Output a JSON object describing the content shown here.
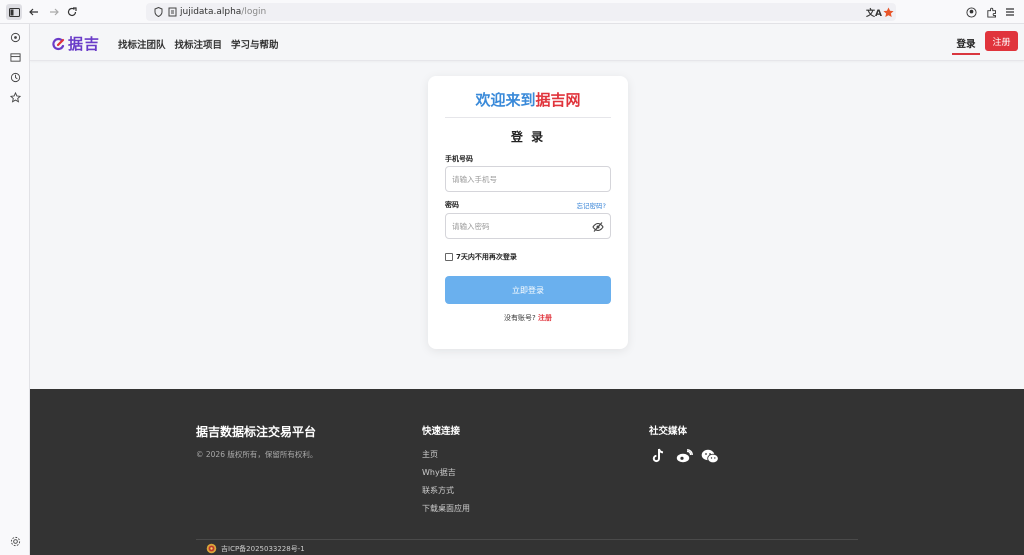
{
  "browser": {
    "url_host": "jujidata.alpha",
    "url_path": "/login"
  },
  "header": {
    "logo_text": "据吉",
    "nav": [
      "找标注团队",
      "找标注项目",
      "学习与帮助"
    ],
    "login_label": "登录",
    "register_label": "注册"
  },
  "card": {
    "welcome_part1": "欢迎来到",
    "welcome_part2": "据吉网",
    "title": "登 录",
    "phone_label": "手机号码",
    "phone_placeholder": "请输入手机号",
    "password_label": "密码",
    "forgot_label": "忘记密码?",
    "password_placeholder": "请输入密码",
    "remember_label": "7天内不用再次登录",
    "submit_label": "立即登录",
    "no_account_text": "没有账号? ",
    "register_link": "注册"
  },
  "footer": {
    "brand_title": "据吉数据标注交易平台",
    "copyright": "© 2026 版权所有，保留所有权利。",
    "quick_links_heading": "快速连接",
    "quick_links": [
      "主页",
      "Why据吉",
      "联系方式",
      "下载桌面应用"
    ],
    "social_heading": "社交媒体",
    "social_icons": [
      "tiktok-icon",
      "weibo-icon",
      "wechat-icon"
    ],
    "icp": "吉ICP备2025033228号-1"
  },
  "colors": {
    "brand_red": "#e0343c",
    "brand_blue": "#3a8ad9",
    "logo_purple": "#6a3cc8",
    "submit_blue": "#6ab0ee",
    "footer_bg": "#333333"
  }
}
